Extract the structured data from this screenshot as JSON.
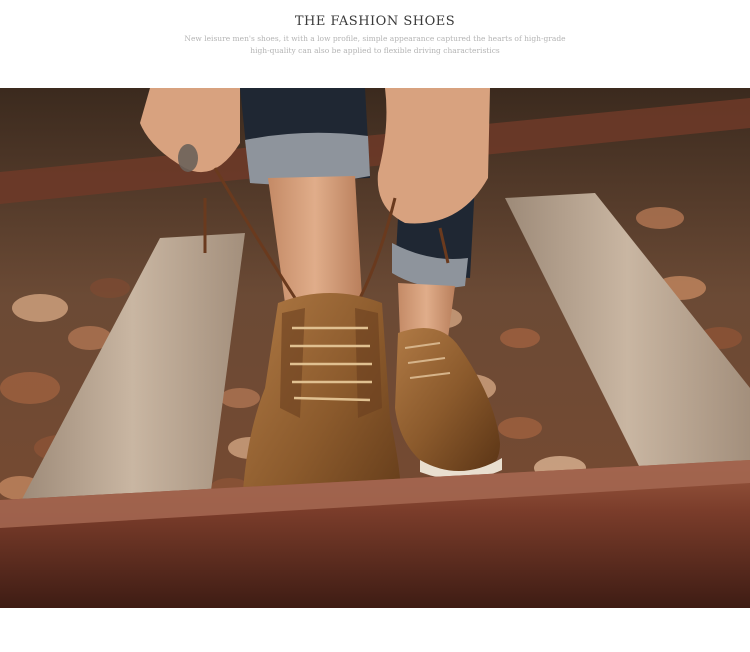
{
  "header": {
    "title": "THE FASHION SHOES",
    "subtitle": "New leisure men's shoes, it with a low profile, simple appearance captured the hearts of high-grade high-quality can also be applied to flexible driving characteristics"
  },
  "photo": {
    "colors": {
      "gravel": "#7a4a32",
      "gravel_light": "#c79a78",
      "sleeper": "#b9a491",
      "rail_top": "#8a4a34",
      "rail_dark": "#4a2218",
      "leather": "#8b5a2c",
      "leather_dark": "#5a3415",
      "sole": "#e9dfcf",
      "denim": "#1f2733",
      "cuff": "#8e949c",
      "skin": "#d8a27f"
    }
  }
}
